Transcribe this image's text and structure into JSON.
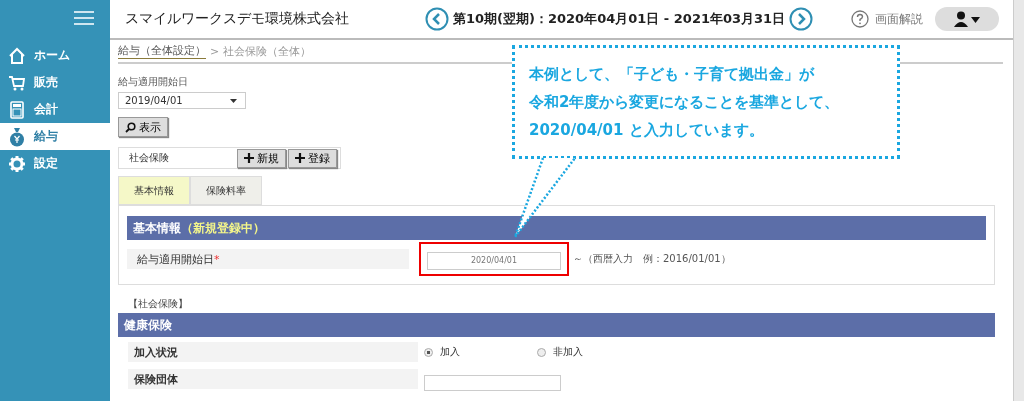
{
  "sidebar": {
    "items": [
      {
        "kind": "home",
        "label": "ホーム",
        "selected": false
      },
      {
        "kind": "cart",
        "label": "販売",
        "selected": false
      },
      {
        "kind": "calc",
        "label": "会計",
        "selected": false
      },
      {
        "kind": "bag",
        "label": "給与",
        "selected": true
      },
      {
        "kind": "gear",
        "label": "設定",
        "selected": false
      }
    ]
  },
  "header": {
    "company": "スマイルワークスデモ環境株式会社",
    "period": "第10期(翌期)：2020年04月01日 - 2021年03月31日",
    "help": "画面解説"
  },
  "breadcrumb": {
    "items": [
      "給与（全体設定）",
      "社会保険（全体）"
    ],
    "separator": ">"
  },
  "filter": {
    "label": "給与適用開始日",
    "value": "2019/04/01",
    "button": "表示"
  },
  "panel": {
    "title": "社会保険",
    "buttons": [
      "新規",
      "登録"
    ]
  },
  "tabs": [
    {
      "label": "基本情報",
      "selected": true
    },
    {
      "label": "保険料率",
      "selected": false
    }
  ],
  "basic": {
    "title": "基本情報",
    "status": "（新規登録中）",
    "field": {
      "label": "給与適用開始日",
      "required_mark": "*",
      "value": "2020/04/01",
      "hint": "～（西暦入力　例：2016/01/01）",
      "highlighted": true
    }
  },
  "health": {
    "group_label": "【社会保険】",
    "title": "健康保険",
    "rows": [
      {
        "kind": "radio",
        "label": "加入状況",
        "options": [
          {
            "label": "加入",
            "selected": true
          },
          {
            "label": "非加入",
            "selected": false
          }
        ]
      },
      {
        "kind": "select",
        "label": "保険団体"
      }
    ]
  },
  "callout": {
    "lines": [
      "本例として、「子ども・子育て拠出金」が",
      "令和2年度から変更になることを基準として、",
      "2020/04/01 と入力しています。"
    ]
  }
}
